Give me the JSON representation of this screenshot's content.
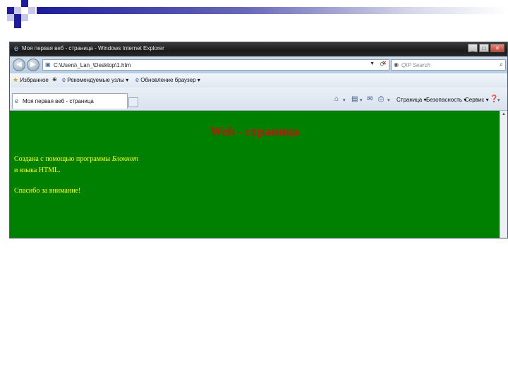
{
  "browser": {
    "title": "Моя первая веб - страница - Windows Internet Explorer",
    "address": "C:\\Users\\_Lan_\\Desktop\\1.htm",
    "search_placeholder": "QIP Search",
    "favorites": [
      {
        "label": "Избранное",
        "icon": "star-icon"
      },
      {
        "label": "Рекомендуемые узлы",
        "icon": "ie-icon"
      },
      {
        "label": "Обновление браузер",
        "icon": "ie-icon"
      }
    ],
    "tab_label": "Моя первая веб - страница",
    "commands": {
      "page": "Страница",
      "safety": "Безопасность",
      "tools": "Сервис"
    }
  },
  "page": {
    "heading": "Web - страница",
    "line1_prefix": "Создана с помощью программы ",
    "line1_italic": "Блокнот",
    "line2": "и языка HTML.",
    "line3": "Спасибо за внимание!",
    "background_color": "#008000",
    "heading_color": "#cc1010",
    "text_color": "#ffff00"
  }
}
